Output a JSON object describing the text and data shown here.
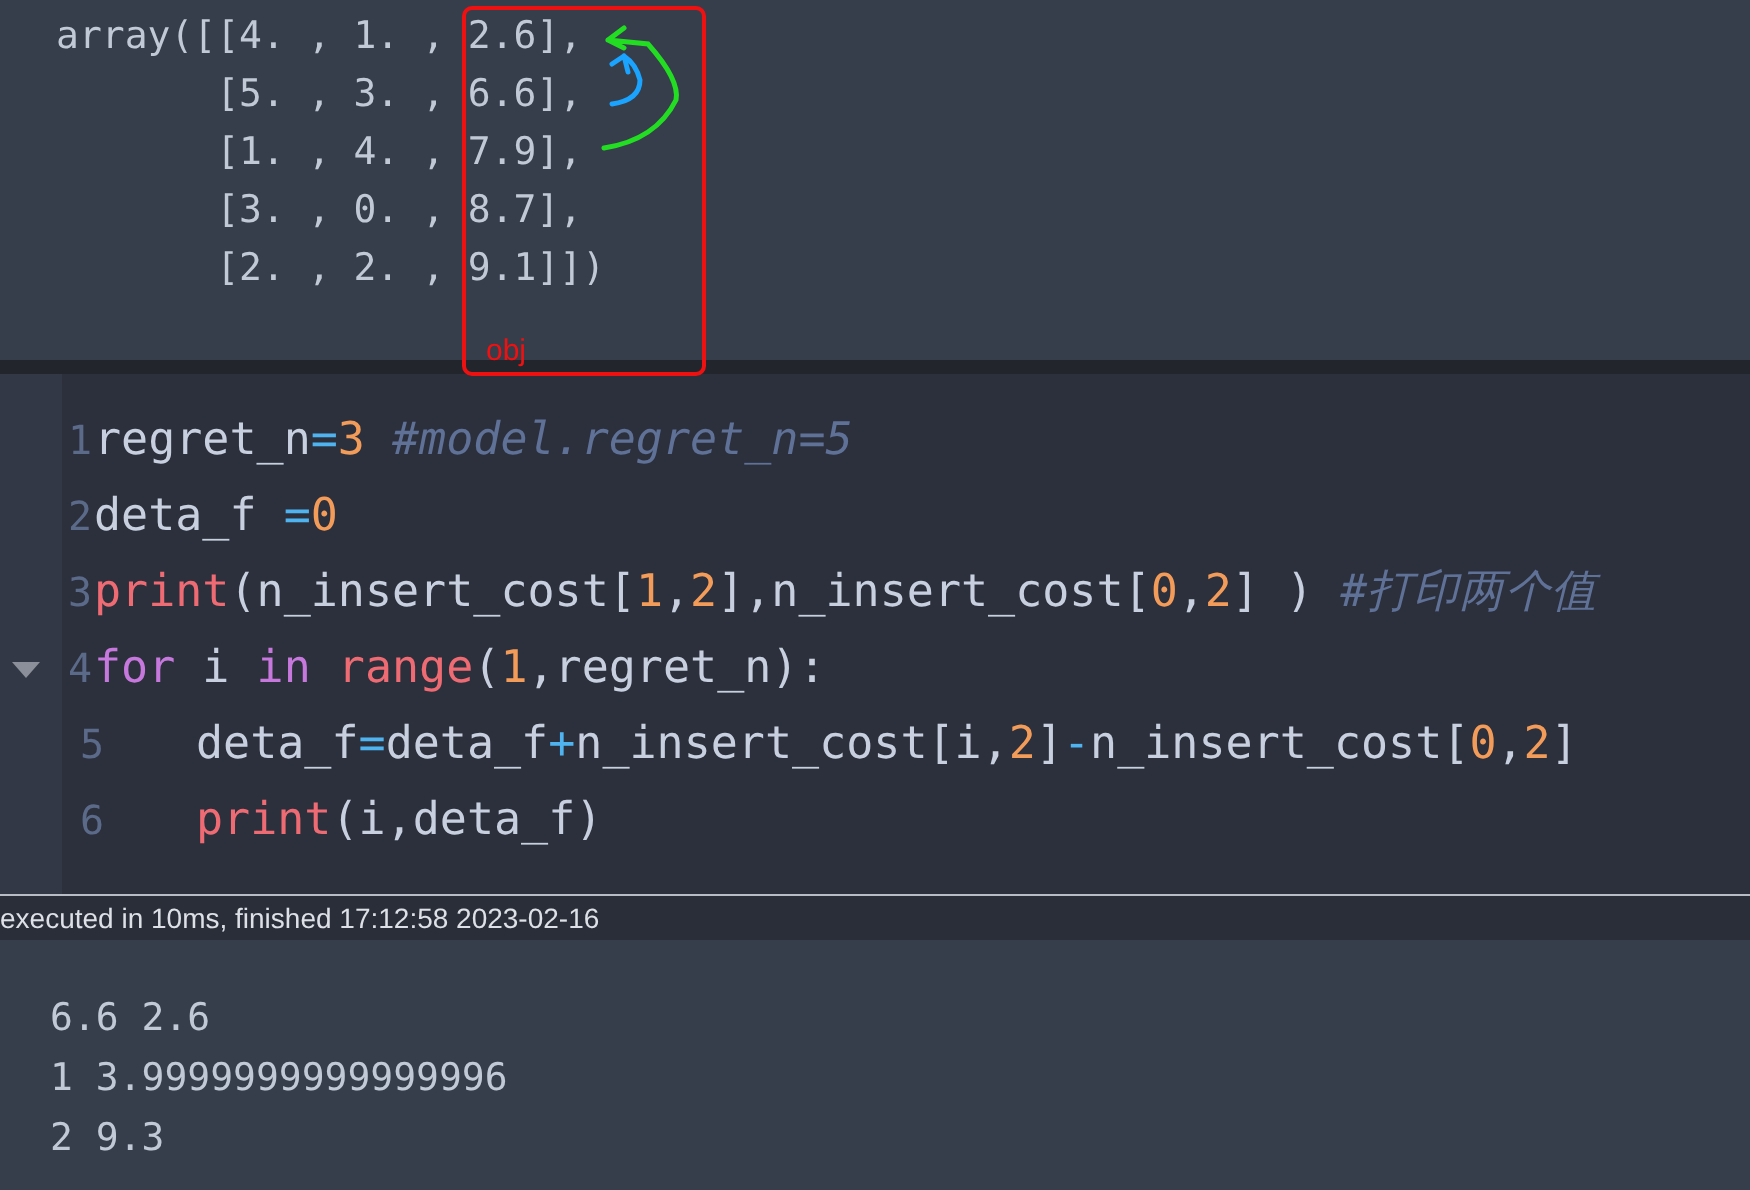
{
  "previous_output": {
    "lines": [
      "array([[4. , 1. , 2.6],",
      "       [5. , 3. , 6.6],",
      "       [1. , 4. , 7.9],",
      "       [3. , 0. , 8.7],",
      "       [2. , 2. , 9.1]])"
    ]
  },
  "annotation": {
    "label": "obj"
  },
  "code_cell": {
    "lines": [
      {
        "number": "1",
        "tokens": [
          {
            "kind": "name",
            "text": "regret_n"
          },
          {
            "kind": "op",
            "text": "="
          },
          {
            "kind": "num",
            "text": "3 "
          },
          {
            "kind": "comment",
            "text": "#model.regret_n=5"
          }
        ]
      },
      {
        "number": "2",
        "tokens": [
          {
            "kind": "name",
            "text": "deta_f "
          },
          {
            "kind": "op",
            "text": "="
          },
          {
            "kind": "num",
            "text": "0"
          }
        ]
      },
      {
        "number": "3",
        "tokens": [
          {
            "kind": "builtin",
            "text": "print"
          },
          {
            "kind": "name",
            "text": "(n_insert_cost["
          },
          {
            "kind": "num",
            "text": "1"
          },
          {
            "kind": "name",
            "text": ","
          },
          {
            "kind": "num",
            "text": "2"
          },
          {
            "kind": "name",
            "text": "],n_insert_cost["
          },
          {
            "kind": "num",
            "text": "0"
          },
          {
            "kind": "name",
            "text": ","
          },
          {
            "kind": "num",
            "text": "2"
          },
          {
            "kind": "name",
            "text": "] ) "
          },
          {
            "kind": "comment",
            "text": "#打印两个值"
          }
        ]
      },
      {
        "number": "4",
        "expanded": true,
        "tokens": [
          {
            "kind": "keyword",
            "text": "for"
          },
          {
            "kind": "name",
            "text": " i "
          },
          {
            "kind": "keyword",
            "text": "in "
          },
          {
            "kind": "builtin",
            "text": "range"
          },
          {
            "kind": "name",
            "text": "("
          },
          {
            "kind": "num",
            "text": "1"
          },
          {
            "kind": "name",
            "text": ",regret_n):"
          }
        ],
        "children": [
          {
            "number": "5",
            "tokens": [
              {
                "kind": "name",
                "text": "deta_f"
              },
              {
                "kind": "op",
                "text": "="
              },
              {
                "kind": "name",
                "text": "deta_f"
              },
              {
                "kind": "op",
                "text": "+"
              },
              {
                "kind": "name",
                "text": "n_insert_cost[i,"
              },
              {
                "kind": "num",
                "text": "2"
              },
              {
                "kind": "name",
                "text": "]"
              },
              {
                "kind": "op",
                "text": "-"
              },
              {
                "kind": "name",
                "text": "n_insert_cost["
              },
              {
                "kind": "num",
                "text": "0"
              },
              {
                "kind": "name",
                "text": ","
              },
              {
                "kind": "num",
                "text": "2"
              },
              {
                "kind": "name",
                "text": "]"
              }
            ]
          },
          {
            "number": "6",
            "tokens": [
              {
                "kind": "builtin",
                "text": "print"
              },
              {
                "kind": "name",
                "text": "(i,deta_f)"
              }
            ]
          }
        ]
      }
    ]
  },
  "status": "executed in 10ms, finished 17:12:58 2023-02-16",
  "output": {
    "lines": [
      "6.6 2.6",
      "1 3.9999999999999996",
      "2 9.3"
    ]
  }
}
